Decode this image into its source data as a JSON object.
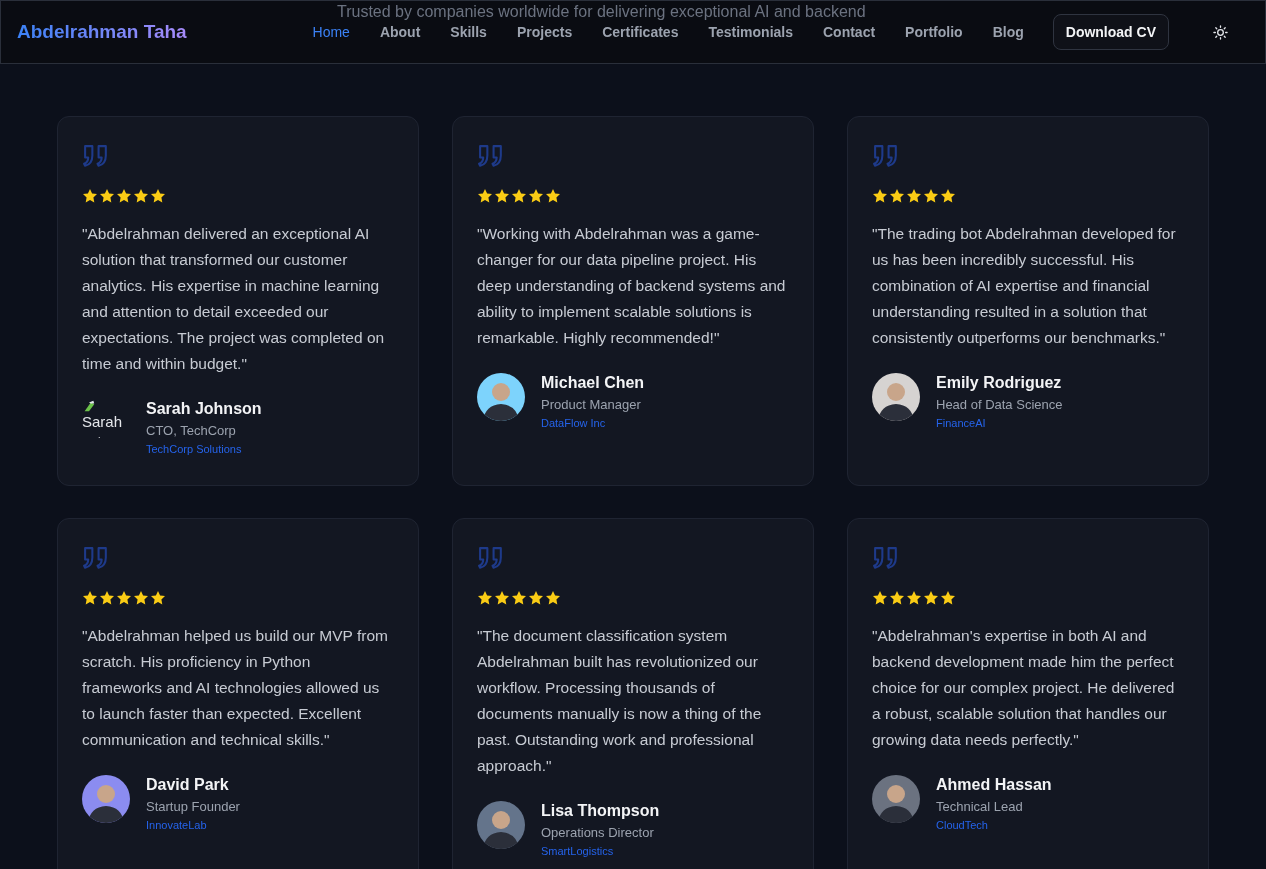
{
  "header": {
    "brand": "Abdelrahman Taha",
    "behind_text": "Trusted by companies worldwide for delivering exceptional AI and backend",
    "nav": [
      {
        "label": "Home",
        "selected": true
      },
      {
        "label": "About",
        "selected": false
      },
      {
        "label": "Skills",
        "selected": false
      },
      {
        "label": "Projects",
        "selected": false
      },
      {
        "label": "Certificates",
        "selected": false
      },
      {
        "label": "Testimonials",
        "selected": false
      },
      {
        "label": "Contact",
        "selected": false
      },
      {
        "label": "Portfolio",
        "selected": false
      },
      {
        "label": "Blog",
        "selected": false
      }
    ],
    "cta": "Download CV"
  },
  "testimonials": [
    {
      "stars": 5,
      "quote": "\"Abdelrahman delivered an exceptional AI solution that transformed our customer analytics. His expertise in machine learning and attention to detail exceeded our expectations. The project was completed on time and within budget.\"",
      "avatar": {
        "kind": "broken",
        "alt": "Sarah",
        "alt_tail": "."
      },
      "name": "Sarah Johnson",
      "role": "CTO, TechCorp",
      "company": "TechCorp Solutions"
    },
    {
      "stars": 5,
      "quote": "\"Working with Abdelrahman was a game-changer for our data pipeline project. His deep understanding of backend systems and ability to implement scalable solutions is remarkable. Highly recommended!\"",
      "avatar": {
        "kind": "photo"
      },
      "name": "Michael Chen",
      "role": "Product Manager",
      "company": "DataFlow Inc"
    },
    {
      "stars": 5,
      "quote": "\"The trading bot Abdelrahman developed for us has been incredibly successful. His combination of AI expertise and financial understanding resulted in a solution that consistently outperforms our benchmarks.\"",
      "avatar": {
        "kind": "photo"
      },
      "name": "Emily Rodriguez",
      "role": "Head of Data Science",
      "company": "FinanceAI"
    },
    {
      "stars": 5,
      "quote": "\"Abdelrahman helped us build our MVP from scratch. His proficiency in Python frameworks and AI technologies allowed us to launch faster than expected. Excellent communication and technical skills.\"",
      "avatar": {
        "kind": "photo"
      },
      "name": "David Park",
      "role": "Startup Founder",
      "company": "InnovateLab"
    },
    {
      "stars": 5,
      "quote": "\"The document classification system Abdelrahman built has revolutionized our workflow. Processing thousands of documents manually is now a thing of the past. Outstanding work and professional approach.\"",
      "avatar": {
        "kind": "photo"
      },
      "name": "Lisa Thompson",
      "role": "Operations Director",
      "company": "SmartLogistics"
    },
    {
      "stars": 5,
      "quote": "\"Abdelrahman's expertise in both AI and backend development made him the perfect choice for our complex project. He delivered a robust, scalable solution that handles our growing data needs perfectly.\"",
      "avatar": {
        "kind": "photo"
      },
      "name": "Ahmed Hassan",
      "role": "Technical Lead",
      "company": "CloudTech"
    }
  ]
}
